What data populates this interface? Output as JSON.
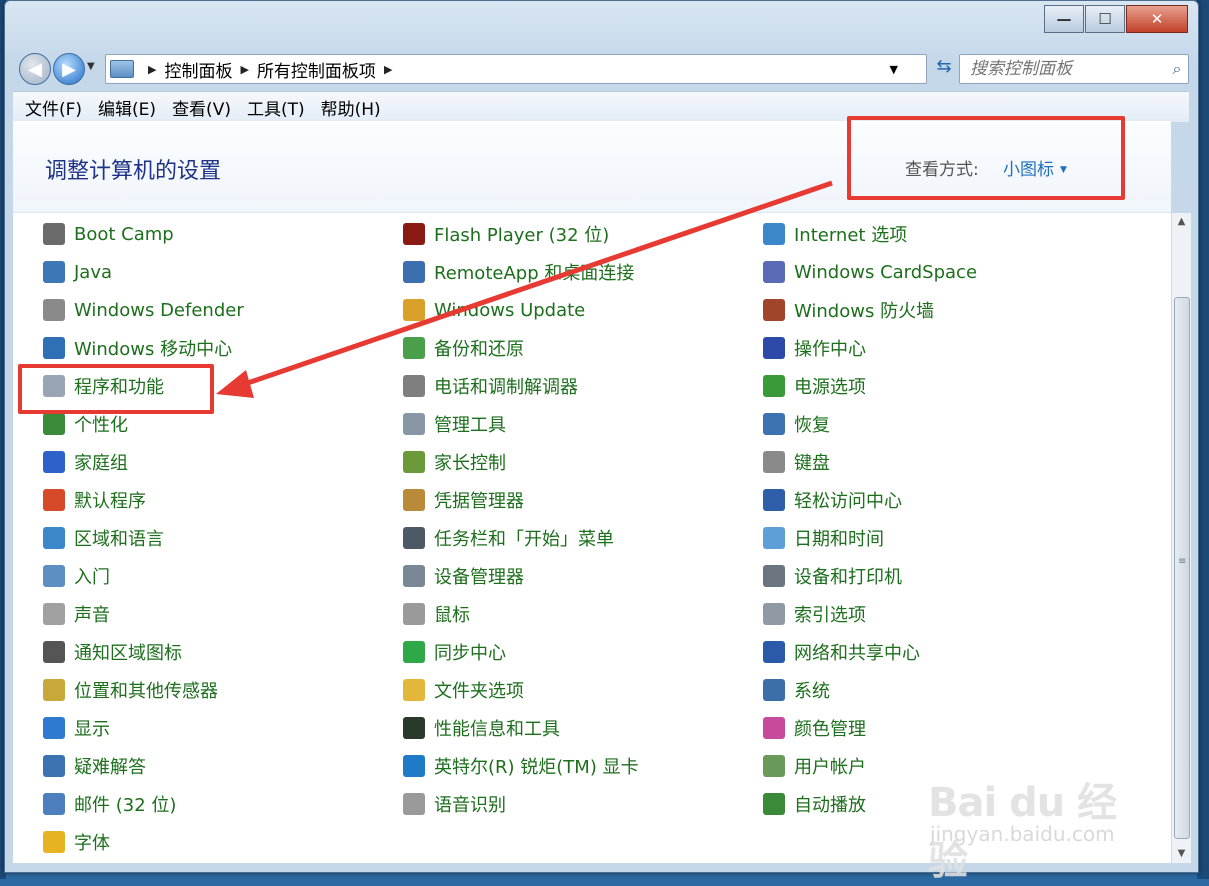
{
  "window": {
    "minimize_label": "—",
    "maximize_label": "☐",
    "close_label": "✕"
  },
  "address": {
    "crumbs": [
      "控制面板",
      "所有控制面板项"
    ],
    "search_placeholder": "搜索控制面板"
  },
  "menu": [
    "文件(F)",
    "编辑(E)",
    "查看(V)",
    "工具(T)",
    "帮助(H)"
  ],
  "header": {
    "title": "调整计算机的设置",
    "view_label": "查看方式:",
    "view_value": "小图标"
  },
  "columns": [
    [
      {
        "label": "Boot Camp",
        "icon": "bootcamp-icon",
        "color": "#6b6b6b"
      },
      {
        "label": "Java",
        "icon": "java-icon",
        "color": "#3b78b5"
      },
      {
        "label": "Windows Defender",
        "icon": "defender-icon",
        "color": "#8a8a8a"
      },
      {
        "label": "Windows 移动中心",
        "icon": "mobility-center-icon",
        "color": "#2f6fb5"
      },
      {
        "label": "程序和功能",
        "icon": "programs-features-icon",
        "color": "#9aa5b3"
      },
      {
        "label": "个性化",
        "icon": "personalization-icon",
        "color": "#3a8a3a"
      },
      {
        "label": "家庭组",
        "icon": "homegroup-icon",
        "color": "#2d63c8"
      },
      {
        "label": "默认程序",
        "icon": "default-programs-icon",
        "color": "#d64a2a"
      },
      {
        "label": "区域和语言",
        "icon": "region-language-icon",
        "color": "#3c87c9"
      },
      {
        "label": "入门",
        "icon": "getting-started-icon",
        "color": "#5d8fc4"
      },
      {
        "label": "声音",
        "icon": "sound-icon",
        "color": "#a0a0a0"
      },
      {
        "label": "通知区域图标",
        "icon": "notification-icons-icon",
        "color": "#555555"
      },
      {
        "label": "位置和其他传感器",
        "icon": "location-sensors-icon",
        "color": "#c9a83a"
      },
      {
        "label": "显示",
        "icon": "display-icon",
        "color": "#2f7ad1"
      },
      {
        "label": "疑难解答",
        "icon": "troubleshooting-icon",
        "color": "#3d72b0"
      },
      {
        "label": "邮件 (32 位)",
        "icon": "mail-icon",
        "color": "#4d7fbf"
      },
      {
        "label": "字体",
        "icon": "fonts-icon",
        "color": "#e6b422"
      }
    ],
    [
      {
        "label": "Flash Player (32 位)",
        "icon": "flash-player-icon",
        "color": "#8b1a14"
      },
      {
        "label": "RemoteApp 和桌面连接",
        "icon": "remoteapp-icon",
        "color": "#3b6fb0"
      },
      {
        "label": "Windows Update",
        "icon": "windows-update-icon",
        "color": "#d9a02a"
      },
      {
        "label": "备份和还原",
        "icon": "backup-restore-icon",
        "color": "#4aa04a"
      },
      {
        "label": "电话和调制解调器",
        "icon": "phone-modem-icon",
        "color": "#7f7f7f"
      },
      {
        "label": "管理工具",
        "icon": "admin-tools-icon",
        "color": "#8896a6"
      },
      {
        "label": "家长控制",
        "icon": "parental-controls-icon",
        "color": "#6a9a3a"
      },
      {
        "label": "凭据管理器",
        "icon": "credential-manager-icon",
        "color": "#b88a3a"
      },
      {
        "label": "任务栏和「开始」菜单",
        "icon": "taskbar-start-icon",
        "color": "#4d5a66"
      },
      {
        "label": "设备管理器",
        "icon": "device-manager-icon",
        "color": "#7a8795"
      },
      {
        "label": "鼠标",
        "icon": "mouse-icon",
        "color": "#9a9a9a"
      },
      {
        "label": "同步中心",
        "icon": "sync-center-icon",
        "color": "#2fa84a"
      },
      {
        "label": "文件夹选项",
        "icon": "folder-options-icon",
        "color": "#e3b83a"
      },
      {
        "label": "性能信息和工具",
        "icon": "performance-icon",
        "color": "#2a3a2a"
      },
      {
        "label": "英特尔(R) 锐炬(TM) 显卡",
        "icon": "intel-graphics-icon",
        "color": "#1f7ac8"
      },
      {
        "label": "语音识别",
        "icon": "speech-recognition-icon",
        "color": "#9a9a9a"
      }
    ],
    [
      {
        "label": "Internet 选项",
        "icon": "internet-options-icon",
        "color": "#3c87c9"
      },
      {
        "label": "Windows CardSpace",
        "icon": "cardspace-icon",
        "color": "#5a6ab5"
      },
      {
        "label": "Windows 防火墙",
        "icon": "firewall-icon",
        "color": "#a0452a"
      },
      {
        "label": "操作中心",
        "icon": "action-center-icon",
        "color": "#2d4aa8"
      },
      {
        "label": "电源选项",
        "icon": "power-options-icon",
        "color": "#3a9a3a"
      },
      {
        "label": "恢复",
        "icon": "recovery-icon",
        "color": "#3d72b0"
      },
      {
        "label": "键盘",
        "icon": "keyboard-icon",
        "color": "#8a8a8a"
      },
      {
        "label": "轻松访问中心",
        "icon": "ease-of-access-icon",
        "color": "#2e5fa8"
      },
      {
        "label": "日期和时间",
        "icon": "date-time-icon",
        "color": "#5d9fd6"
      },
      {
        "label": "设备和打印机",
        "icon": "devices-printers-icon",
        "color": "#6a7580"
      },
      {
        "label": "索引选项",
        "icon": "indexing-options-icon",
        "color": "#8f9aa5"
      },
      {
        "label": "网络和共享中心",
        "icon": "network-sharing-icon",
        "color": "#2a5aa8"
      },
      {
        "label": "系统",
        "icon": "system-icon",
        "color": "#3c6ea8"
      },
      {
        "label": "颜色管理",
        "icon": "color-management-icon",
        "color": "#c84a9a"
      },
      {
        "label": "用户帐户",
        "icon": "user-accounts-icon",
        "color": "#6a9a5a"
      },
      {
        "label": "自动播放",
        "icon": "autoplay-icon",
        "color": "#3a8a3a"
      }
    ]
  ],
  "watermark": {
    "main": "Bai du 经验",
    "sub": "jingyan.baidu.com"
  },
  "colors": {
    "link_green": "#1d6f1d",
    "title_blue": "#1e3287",
    "annotation_red": "#e63a32"
  }
}
